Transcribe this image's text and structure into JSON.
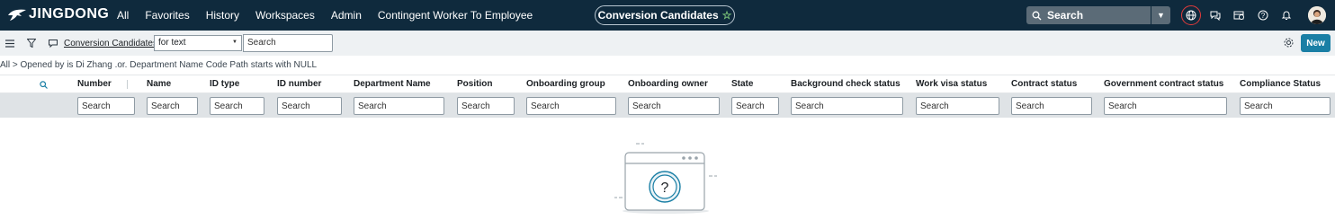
{
  "brand": {
    "name": "JINGDONG"
  },
  "nav": {
    "items": [
      "All",
      "Favorites",
      "History",
      "Workspaces",
      "Admin",
      "Contingent Worker To Employee"
    ]
  },
  "title_pill": {
    "label": "Conversion Candidates",
    "star": "☆"
  },
  "global_search": {
    "placeholder": "Search"
  },
  "header_icons": [
    "globe-icon",
    "chat-icon",
    "inbox-icon",
    "help-icon",
    "bell-icon",
    "avatar"
  ],
  "toolbar": {
    "list_title": "Conversion Candidates",
    "field_select": "for text",
    "search_placeholder": "Search",
    "new_label": "New"
  },
  "breadcrumb": "All > Opened by is Di Zhang .or. Department Name Code Path starts with NULL",
  "columns": [
    "Number",
    "Name",
    "ID type",
    "ID number",
    "Department Name",
    "Position",
    "Onboarding group",
    "Onboarding owner",
    "State",
    "Background check status",
    "Work visa status",
    "Contract status",
    "Government contract status",
    "Compliance Status"
  ],
  "filter_placeholder": "Search",
  "colors": {
    "topbar": "#0f2a3d",
    "accent": "#1a7fa5",
    "toolbar": "#eef1f3",
    "filter_row": "#dfe3e6"
  }
}
